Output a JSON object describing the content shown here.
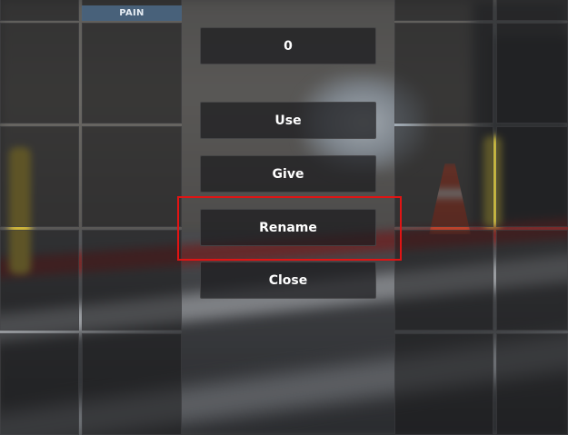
{
  "inventory": {
    "slot_label": "PAIN"
  },
  "amount_input": {
    "value": "0"
  },
  "actions": {
    "use_label": "Use",
    "give_label": "Give",
    "rename_label": "Rename",
    "close_label": "Close"
  },
  "highlight": {
    "target": "rename-button",
    "color": "#e01414"
  },
  "colors": {
    "slot_label_bg": "#4a6682",
    "button_text": "#ffffff"
  }
}
